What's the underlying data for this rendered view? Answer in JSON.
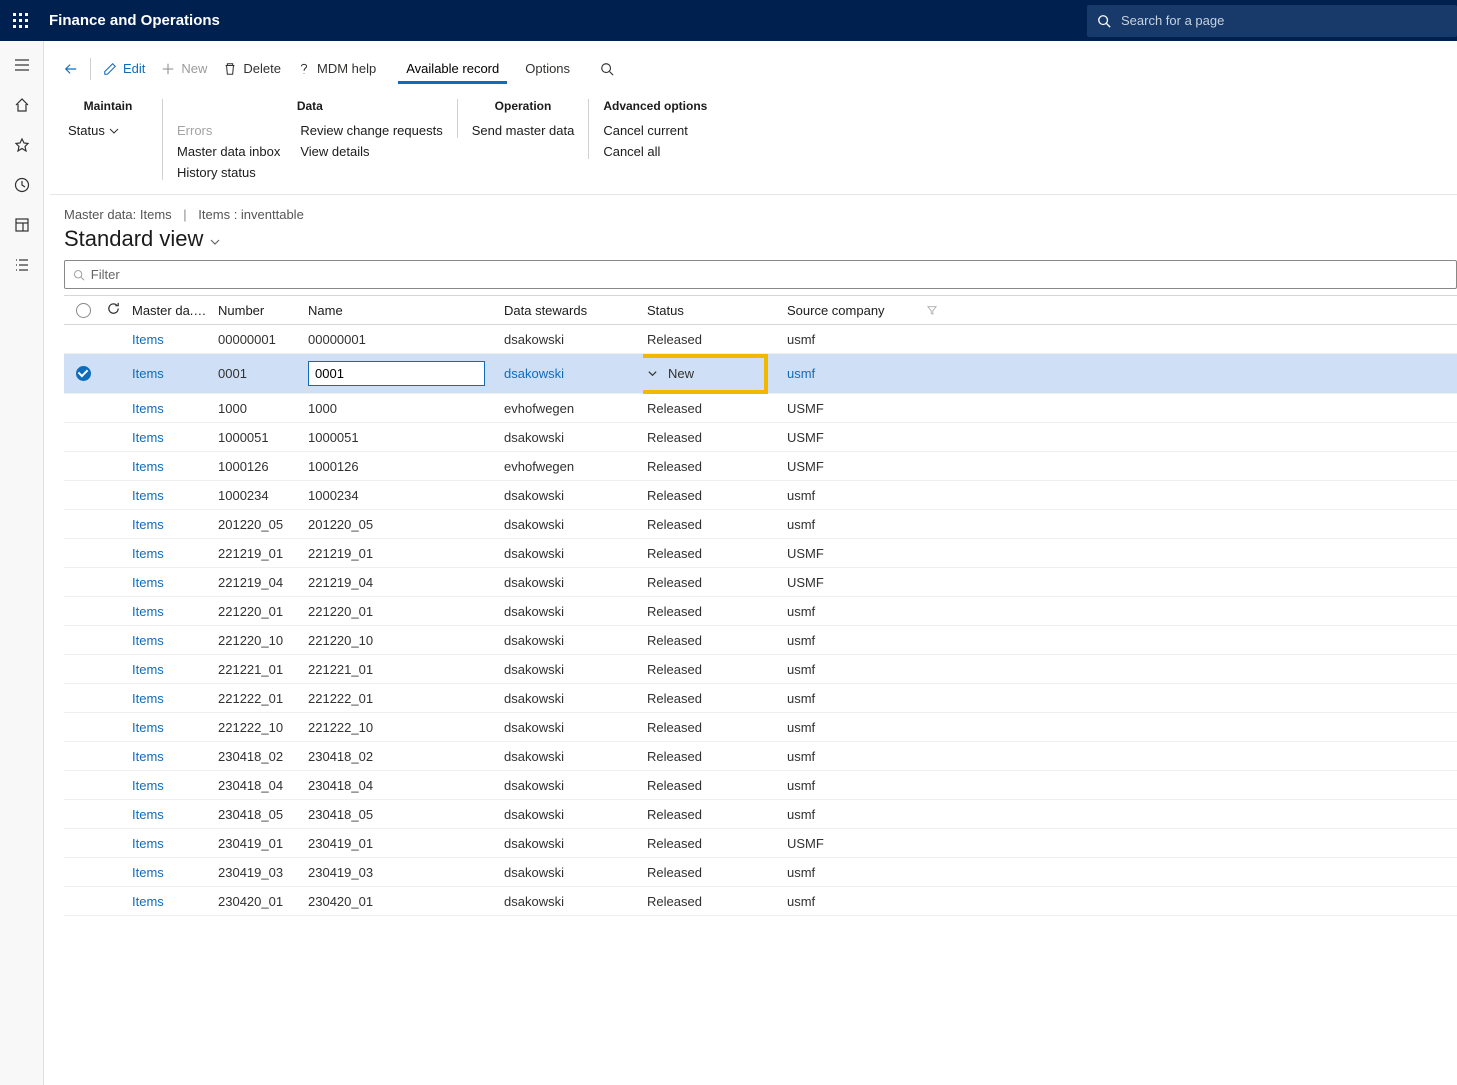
{
  "header": {
    "app_title": "Finance and Operations",
    "search_placeholder": "Search for a page"
  },
  "toolbar": {
    "edit": "Edit",
    "new": "New",
    "delete": "Delete",
    "mdm_help": "MDM help",
    "available_record": "Available record",
    "options": "Options"
  },
  "ribbon": {
    "maintain": {
      "title": "Maintain",
      "status": "Status"
    },
    "data": {
      "title": "Data",
      "errors": "Errors",
      "master_inbox": "Master data inbox",
      "history_status": "History status",
      "review": "Review change requests",
      "view_details": "View details"
    },
    "operation": {
      "title": "Operation",
      "send": "Send master data"
    },
    "advanced": {
      "title": "Advanced options",
      "cancel_current": "Cancel current",
      "cancel_all": "Cancel all"
    }
  },
  "breadcrumb": {
    "a": "Master data: Items",
    "b": "Items : inventtable"
  },
  "view_title": "Standard view",
  "filter_placeholder": "Filter",
  "columns": {
    "master": "Master da...",
    "number": "Number",
    "name": "Name",
    "stewards": "Data stewards",
    "status": "Status",
    "company": "Source company"
  },
  "selected_index": 1,
  "rows": [
    {
      "master": "Items",
      "number": "00000001",
      "name": "00000001",
      "steward": "dsakowski",
      "status": "Released",
      "company": "usmf"
    },
    {
      "master": "Items",
      "number": "0001",
      "name": "0001",
      "steward": "dsakowski",
      "status": "New",
      "company": "usmf"
    },
    {
      "master": "Items",
      "number": "1000",
      "name": "1000",
      "steward": "evhofwegen",
      "status": "Released",
      "company": "USMF"
    },
    {
      "master": "Items",
      "number": "1000051",
      "name": "1000051",
      "steward": "dsakowski",
      "status": "Released",
      "company": "USMF"
    },
    {
      "master": "Items",
      "number": "1000126",
      "name": "1000126",
      "steward": "evhofwegen",
      "status": "Released",
      "company": "USMF"
    },
    {
      "master": "Items",
      "number": "1000234",
      "name": "1000234",
      "steward": "dsakowski",
      "status": "Released",
      "company": "usmf"
    },
    {
      "master": "Items",
      "number": "201220_05",
      "name": "201220_05",
      "steward": "dsakowski",
      "status": "Released",
      "company": "usmf"
    },
    {
      "master": "Items",
      "number": "221219_01",
      "name": "221219_01",
      "steward": "dsakowski",
      "status": "Released",
      "company": "USMF"
    },
    {
      "master": "Items",
      "number": "221219_04",
      "name": "221219_04",
      "steward": "dsakowski",
      "status": "Released",
      "company": "USMF"
    },
    {
      "master": "Items",
      "number": "221220_01",
      "name": "221220_01",
      "steward": "dsakowski",
      "status": "Released",
      "company": "usmf"
    },
    {
      "master": "Items",
      "number": "221220_10",
      "name": "221220_10",
      "steward": "dsakowski",
      "status": "Released",
      "company": "usmf"
    },
    {
      "master": "Items",
      "number": "221221_01",
      "name": "221221_01",
      "steward": "dsakowski",
      "status": "Released",
      "company": "usmf"
    },
    {
      "master": "Items",
      "number": "221222_01",
      "name": "221222_01",
      "steward": "dsakowski",
      "status": "Released",
      "company": "usmf"
    },
    {
      "master": "Items",
      "number": "221222_10",
      "name": "221222_10",
      "steward": "dsakowski",
      "status": "Released",
      "company": "usmf"
    },
    {
      "master": "Items",
      "number": "230418_02",
      "name": "230418_02",
      "steward": "dsakowski",
      "status": "Released",
      "company": "usmf"
    },
    {
      "master": "Items",
      "number": "230418_04",
      "name": "230418_04",
      "steward": "dsakowski",
      "status": "Released",
      "company": "usmf"
    },
    {
      "master": "Items",
      "number": "230418_05",
      "name": "230418_05",
      "steward": "dsakowski",
      "status": "Released",
      "company": "usmf"
    },
    {
      "master": "Items",
      "number": "230419_01",
      "name": "230419_01",
      "steward": "dsakowski",
      "status": "Released",
      "company": "USMF"
    },
    {
      "master": "Items",
      "number": "230419_03",
      "name": "230419_03",
      "steward": "dsakowski",
      "status": "Released",
      "company": "usmf"
    },
    {
      "master": "Items",
      "number": "230420_01",
      "name": "230420_01",
      "steward": "dsakowski",
      "status": "Released",
      "company": "usmf"
    }
  ]
}
